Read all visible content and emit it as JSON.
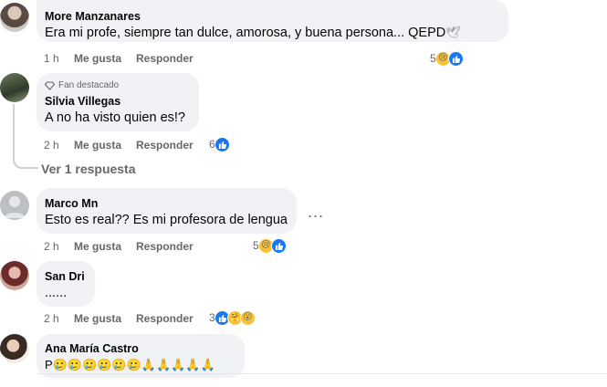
{
  "comments": [
    {
      "author": "More Manzanares",
      "text": "Era mi profe, siempre tan dulce, amorosa, y buena persona... QEPD",
      "trailing_emoji": "🕊",
      "time": "1 h",
      "like_label": "Me gusta",
      "reply_label": "Responder",
      "reaction_count": "5",
      "reaction_icons": [
        "sad-reaction-icon",
        "like-reaction-icon"
      ]
    },
    {
      "badge": "Fan destacado",
      "author": "Silvia Villegas",
      "text": "A no ha visto quien es!?",
      "time": "2 h",
      "like_label": "Me gusta",
      "reply_label": "Responder",
      "reaction_count": "6",
      "reaction_icons": [
        "like-reaction-icon"
      ],
      "more_replies": "Ver 1 respuesta"
    },
    {
      "author": "Marco Mn",
      "text": "Esto es real?? Es mi profesora de lengua",
      "more_options": "...",
      "time": "2 h",
      "like_label": "Me gusta",
      "reply_label": "Responder",
      "reaction_count": "5",
      "reaction_icons": [
        "sad-reaction-icon",
        "like-reaction-icon"
      ]
    },
    {
      "author": "San Dri",
      "text": "......",
      "time": "2 h",
      "like_label": "Me gusta",
      "reply_label": "Responder",
      "reaction_count": "3",
      "reaction_icons": [
        "like-reaction-icon",
        "care-reaction-icon",
        "wow-reaction-icon"
      ]
    },
    {
      "author": "Ana María Castro",
      "text": "P🥲🥲🥲🥲🥲🥲🙏🙏🙏🙏🙏"
    }
  ],
  "colors": {
    "bubble": "#f0f2f5",
    "secondary_text": "#65676b",
    "like_blue": "#1877f2",
    "emoji_yellow": "#f7c23a"
  }
}
